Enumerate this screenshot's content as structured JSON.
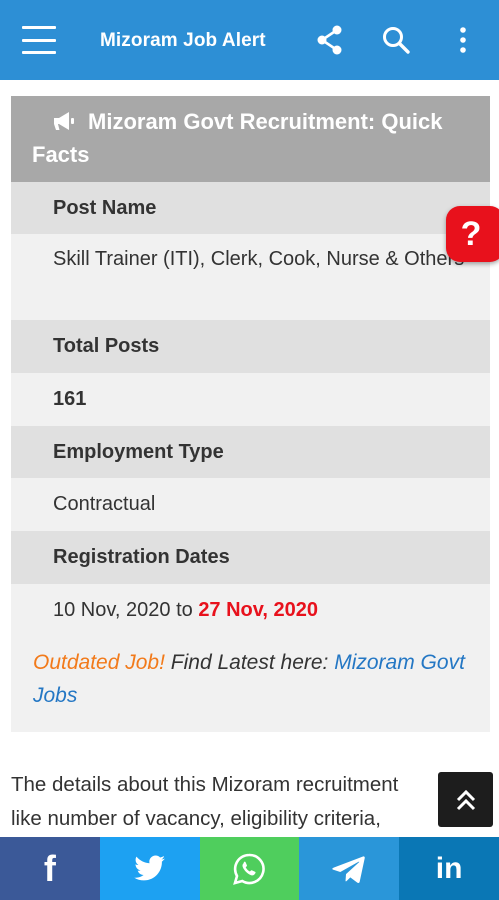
{
  "app": {
    "title": "Mizoram Job Alert"
  },
  "header_icons": {
    "menu": "hamburger-menu-icon",
    "share": "share-icon",
    "search": "search-icon",
    "more": "more-vert-icon"
  },
  "quick_facts": {
    "heading": "Mizoram Govt Recruitment: Quick Facts",
    "rows": [
      {
        "label": "Post Name",
        "value": "Skill Trainer (ITI), Clerk, Cook, Nurse & Others"
      },
      {
        "label": "Total Posts",
        "value": "161"
      },
      {
        "label": "Employment Type",
        "value": "Contractual"
      },
      {
        "label": "Registration Dates",
        "start": "10 Nov, 2020",
        "to": "to",
        "end": "27 Nov, 2020"
      }
    ],
    "outdated": {
      "warning": "Outdated Job!",
      "prompt": "Find Latest here:",
      "link": "Mizoram Govt Jobs"
    }
  },
  "article": {
    "line1": "The details about this Mizoram recruitment",
    "line2": "like number of vacancy, eligibility criteria,"
  },
  "help_button": {
    "label": "?"
  },
  "share_bar": [
    {
      "name": "facebook",
      "label": "f",
      "color": "#3b5998"
    },
    {
      "name": "twitter",
      "color": "#1da1f2"
    },
    {
      "name": "whatsapp",
      "color": "#4fce5d"
    },
    {
      "name": "telegram",
      "color": "#2a96d9"
    },
    {
      "name": "linkedin",
      "label": "in",
      "color": "#0a77b5"
    }
  ],
  "colors": {
    "accent": "#2d8fd5",
    "outdated": "#f27a1a",
    "link": "#2477c4",
    "deadline": "#e8111c"
  }
}
